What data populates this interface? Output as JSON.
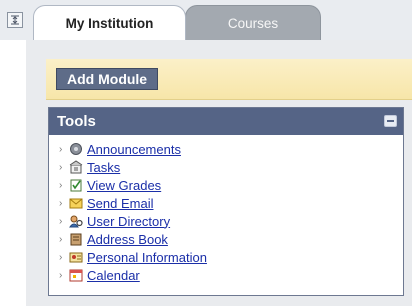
{
  "tabs": [
    {
      "label": "My Institution",
      "active": true
    },
    {
      "label": "Courses",
      "active": false
    }
  ],
  "action_bar": {
    "add_module_label": "Add Module"
  },
  "tools": {
    "title": "Tools",
    "items": [
      {
        "label": "Announcements",
        "icon": "announcements-icon"
      },
      {
        "label": "Tasks",
        "icon": "tasks-icon"
      },
      {
        "label": "View Grades",
        "icon": "view-grades-icon"
      },
      {
        "label": "Send Email",
        "icon": "email-icon"
      },
      {
        "label": "User Directory",
        "icon": "user-directory-icon"
      },
      {
        "label": "Address Book",
        "icon": "address-book-icon"
      },
      {
        "label": "Personal Information",
        "icon": "personal-info-icon"
      },
      {
        "label": "Calendar",
        "icon": "calendar-icon"
      }
    ]
  },
  "colors": {
    "header": "#556486",
    "link": "#1b2fa8",
    "action_bar": "#f8e8b0",
    "inactive_tab": "#a3a9b0"
  }
}
